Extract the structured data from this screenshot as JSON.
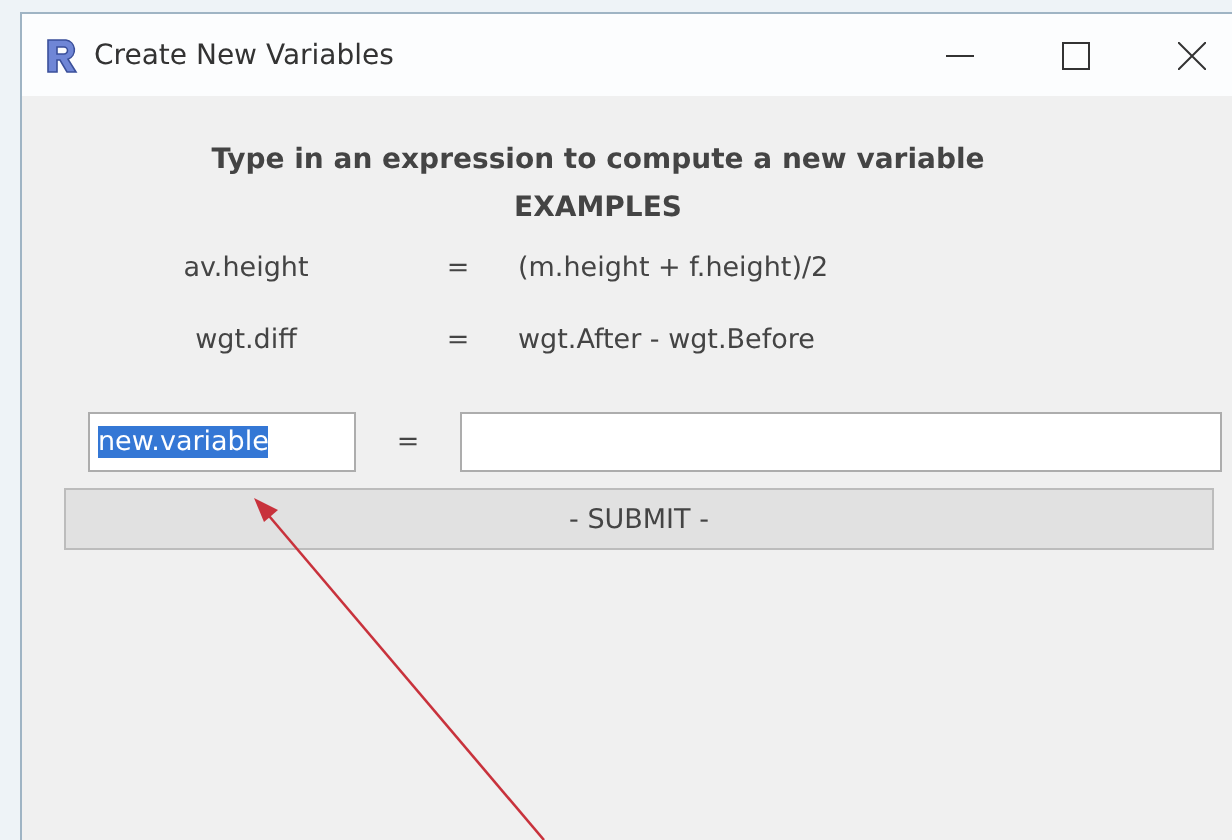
{
  "window": {
    "title": "Create New Variables"
  },
  "heading": "Type in an expression to compute a new variable",
  "examples_title": "EXAMPLES",
  "examples": [
    {
      "name": "av.height",
      "sign": "=",
      "expression": "(m.height + f.height)/2"
    },
    {
      "name": "wgt.diff",
      "sign": "=",
      "expression": "wgt.After - wgt.Before"
    }
  ],
  "form": {
    "name_field": {
      "value": "new.variable",
      "selected": true
    },
    "sign": "=",
    "submit": "- SUBMIT -"
  },
  "annotation": {
    "kind": "arrow"
  }
}
